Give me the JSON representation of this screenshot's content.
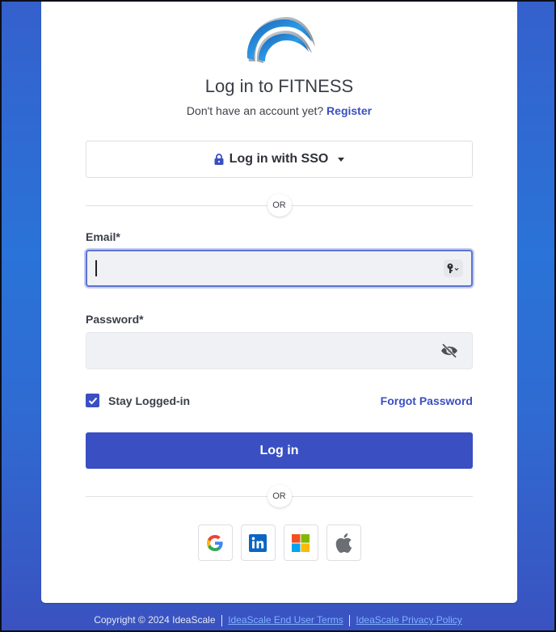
{
  "header": {
    "logo": "fitness-logo",
    "title": "Log in to FITNESS",
    "subtitle_text": "Don't have an account yet?",
    "register_link": "Register"
  },
  "sso": {
    "icon": "lock-icon",
    "label": "Log in with SSO",
    "caret_icon": "caret-down-icon"
  },
  "dividers": {
    "or_label": "OR"
  },
  "form": {
    "email": {
      "label": "Email*",
      "value": "",
      "placeholder": "",
      "icon": "key-icon"
    },
    "password": {
      "label": "Password*",
      "value": "",
      "placeholder": "",
      "icon": "eye-slash-icon"
    },
    "stay_logged_in": {
      "label": "Stay Logged-in",
      "checked": true
    },
    "forgot_password": "Forgot Password",
    "submit_label": "Log in"
  },
  "social_logins": [
    {
      "name": "Google",
      "icon": "google-icon"
    },
    {
      "name": "LinkedIn",
      "icon": "linkedin-icon"
    },
    {
      "name": "Microsoft",
      "icon": "microsoft-icon"
    },
    {
      "name": "Apple",
      "icon": "apple-icon"
    }
  ],
  "footer": {
    "copyright": "Copyright © 2024 IdeaScale",
    "terms_link": "IdeaScale End User Terms",
    "privacy_link": "IdeaScale Privacy Policy"
  },
  "colors": {
    "accent": "#3a4fc2",
    "background_gradient_top": "#3560cc",
    "background_gradient_mid": "#2a73d8",
    "link_footer": "#7fb2ff"
  }
}
